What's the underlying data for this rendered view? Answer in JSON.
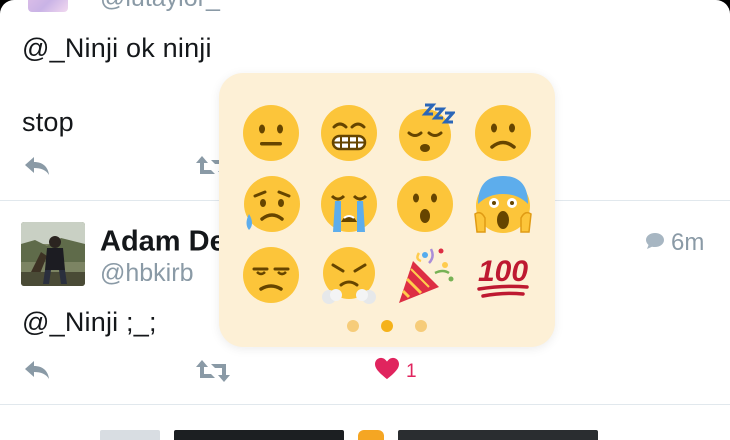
{
  "tweet1": {
    "handle": "@lutaylor_",
    "text": "@_Ninji ok ninji",
    "text2": "stop"
  },
  "tweet2": {
    "name": "Adam Demasi",
    "handle": "@hbkirb",
    "time": "6m",
    "text": "@_Ninji ;_;",
    "like_count": "1"
  },
  "colors": {
    "icon_gray": "#8a9aa6",
    "like_red": "#e0245e",
    "picker_bg": "#fdf0d6",
    "dot_active": "#f5b21a",
    "dot_inactive": "#f6cc7a"
  },
  "picker": {
    "emojis": [
      "neutral-face",
      "grimacing-face",
      "sleeping-face",
      "slightly-frowning-face",
      "sad-sweat-face",
      "loudly-crying-face",
      "hushed-face",
      "screaming-face",
      "unamused-face",
      "triumph-face",
      "party-popper",
      "hundred-points"
    ],
    "hundred_text": "100",
    "page_count": 3,
    "active_page": 2
  }
}
